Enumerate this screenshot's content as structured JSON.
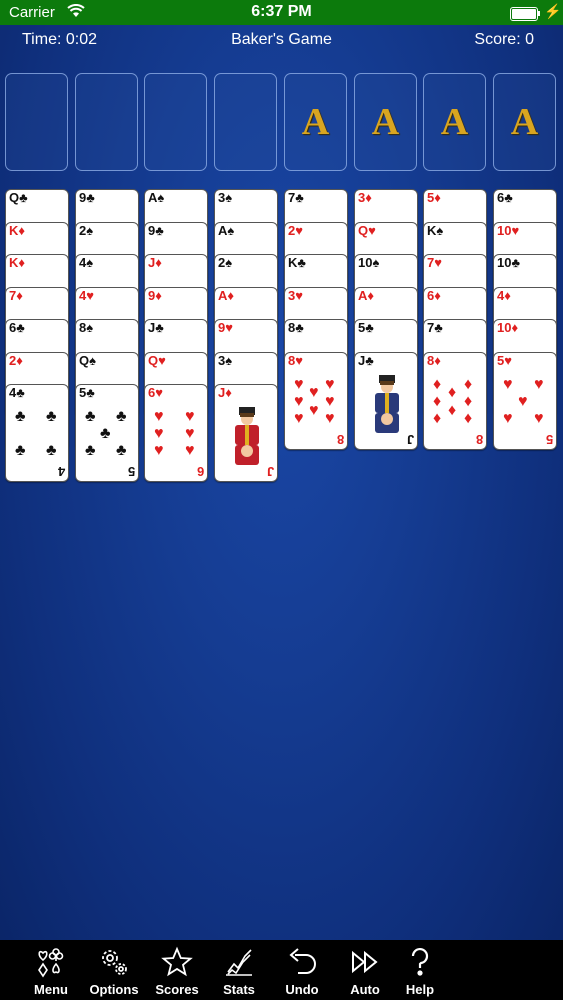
{
  "status_bar": {
    "carrier": "Carrier",
    "time": "6:37 PM"
  },
  "header": {
    "time": "Time: 0:02",
    "title": "Baker's Game",
    "score": "Score: 0"
  },
  "foundations": [
    "A",
    "A",
    "A",
    "A"
  ],
  "columns": [
    [
      "Q♣",
      "K♦",
      "K♦",
      "7♦",
      "6♣",
      "2♦",
      "4♣"
    ],
    [
      "9♣",
      "2♠",
      "4♠",
      "4♥",
      "8♠",
      "Q♠",
      "5♣"
    ],
    [
      "A♠",
      "9♣",
      "J♦",
      "9♦",
      "J♣",
      "Q♥",
      "6♥"
    ],
    [
      "3♠",
      "A♠",
      "2♠",
      "A♦",
      "9♥",
      "3♠",
      "J♦"
    ],
    [
      "7♣",
      "2♥",
      "K♣",
      "3♥",
      "8♣",
      "8♥"
    ],
    [
      "3♦",
      "Q♥",
      "10♠",
      "A♦",
      "5♣",
      "J♣"
    ],
    [
      "5♦",
      "K♠",
      "7♥",
      "6♦",
      "7♣",
      "8♦"
    ],
    [
      "6♣",
      "10♥",
      "10♣",
      "4♦",
      "10♦",
      "5♥"
    ]
  ],
  "toolbar": [
    {
      "label": "Menu",
      "icon": "menu-suits-icon"
    },
    {
      "label": "Options",
      "icon": "gears-icon"
    },
    {
      "label": "Scores",
      "icon": "star-icon"
    },
    {
      "label": "Stats",
      "icon": "chart-icon"
    },
    {
      "label": "Undo",
      "icon": "undo-icon"
    },
    {
      "label": "Auto",
      "icon": "fast-forward-icon"
    },
    {
      "label": "Help",
      "icon": "question-icon"
    }
  ],
  "colors": {
    "felt": "#153c92",
    "status_bar": "#0c7a0c",
    "ace_gold": "#d9a520",
    "red_suit": "#e02020"
  }
}
